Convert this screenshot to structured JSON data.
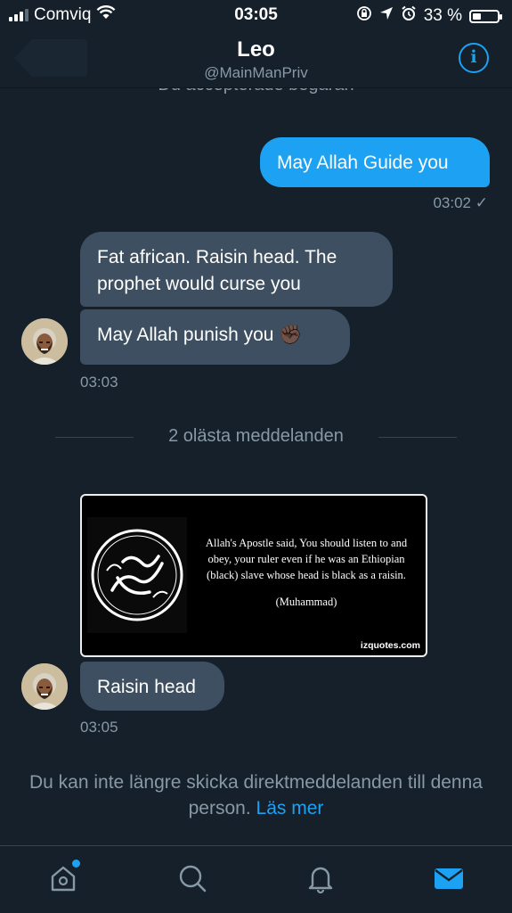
{
  "status_bar": {
    "carrier": "Comviq",
    "time": "03:05",
    "battery_percent": "33 %",
    "battery_level": 0.33,
    "icons": [
      "signal-icon",
      "wifi-icon",
      "rotation-lock-icon",
      "location-arrow-icon",
      "alarm-icon",
      "battery-icon"
    ]
  },
  "header": {
    "name": "Leo",
    "handle": "@MainManPriv",
    "back_icon": "back-arrow-icon",
    "info_icon": "info-icon",
    "info_glyph": "i"
  },
  "conversation": {
    "accepted_notice": "Du accepterade begäran",
    "outgoing": {
      "text": "May Allah Guide you",
      "time": "03:02",
      "read_mark": "✓"
    },
    "incoming_1": {
      "text": "Fat african. Raisin head. The prophet would curse you"
    },
    "incoming_2": {
      "text": "May Allah punish you",
      "emoji": "✊🏿"
    },
    "incoming_time_1": "03:03",
    "unread_divider": "2 olästa meddelanden",
    "image_message": {
      "quote": "Allah's Apostle said, You should listen to and obey, your ruler even if he was an Ethiopian (black) slave whose head is black as a raisin.",
      "author": "(Muhammad)",
      "watermark": "izquotes.com"
    },
    "incoming_3": {
      "text": "Raisin head"
    },
    "incoming_time_2": "03:05"
  },
  "blocked_notice": {
    "text": "Du kan inte längre skicka direktmeddelanden till denna person.",
    "link": "Läs mer"
  },
  "tab_bar": {
    "tabs": [
      "home-icon",
      "search-icon",
      "notifications-icon",
      "messages-icon"
    ],
    "active": "messages-icon",
    "colors": {
      "active": "#1da1f2",
      "inactive": "#8899a6"
    }
  },
  "colors": {
    "background": "#15202b",
    "outgoing_bubble": "#1da1f2",
    "incoming_bubble": "#3d4f60",
    "secondary_text": "#8899a6",
    "link": "#1da1f2"
  }
}
